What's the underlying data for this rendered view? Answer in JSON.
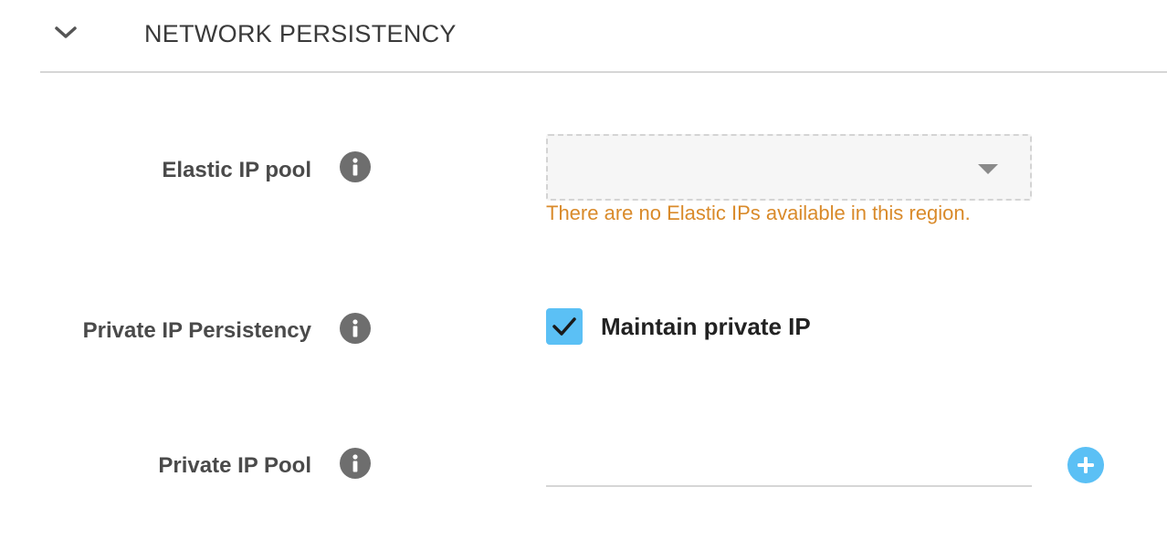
{
  "section": {
    "title": "NETWORK PERSISTENCY",
    "toggle_icon": "chevron-down-icon",
    "expanded": true
  },
  "elastic_ip_pool": {
    "label": "Elastic IP pool",
    "info_icon": "info-icon",
    "selected_value": "",
    "warning": "There are no Elastic IPs available in this region."
  },
  "private_ip_persistency": {
    "label": "Private IP Persistency",
    "info_icon": "info-icon",
    "checkbox_label": "Maintain private IP",
    "checked": true
  },
  "private_ip_pool": {
    "label": "Private IP Pool",
    "info_icon": "info-icon",
    "input_value": "",
    "add_icon": "plus-icon"
  },
  "colors": {
    "accent": "#5bc0f5",
    "warning": "#d98a2a",
    "info_icon_bg": "#6e6e6e",
    "divider": "#d6d6d6"
  }
}
